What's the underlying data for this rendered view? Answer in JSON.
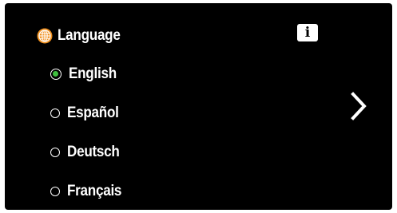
{
  "header": {
    "icon": "globe-icon",
    "title": "Language"
  },
  "info_button": {
    "icon": "info-icon",
    "label": "i"
  },
  "options": [
    {
      "label": "English",
      "selected": true
    },
    {
      "label": "Español",
      "selected": false
    },
    {
      "label": "Deutsch",
      "selected": false
    },
    {
      "label": "Français",
      "selected": false
    }
  ],
  "navigation": {
    "next_icon": "chevron-right-icon"
  },
  "colors": {
    "background": "#000000",
    "text": "#ffffff",
    "selected_radio": "#3fbf3f",
    "globe": "#f0901e"
  }
}
